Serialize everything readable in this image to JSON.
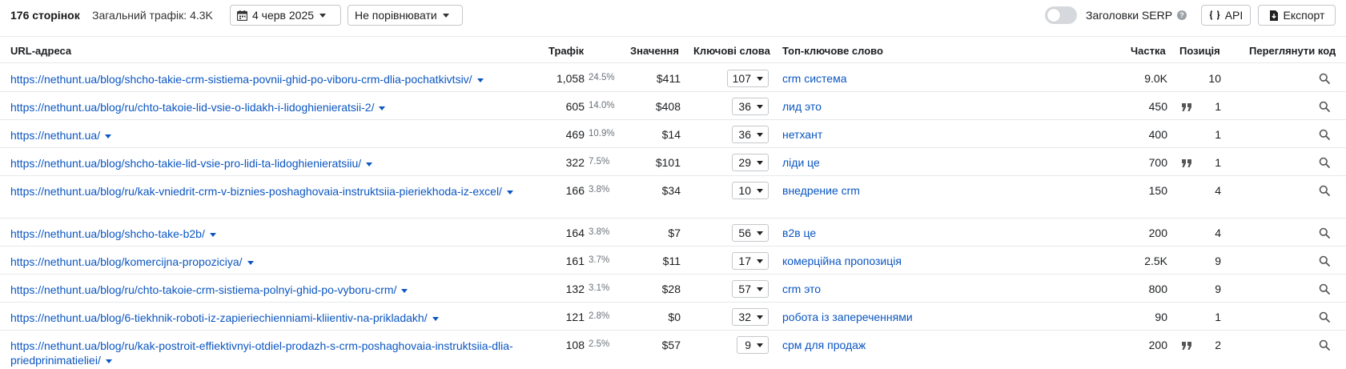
{
  "header": {
    "pages_count": "176 сторінок",
    "total_traffic": "Загальний трафік: 4.3K",
    "date_label": "4 черв 2025",
    "compare_label": "Не порівнювати",
    "serp_titles_label": "Заголовки SERP",
    "serp_toggle_on": false,
    "help_glyph": "?",
    "api_label": "API",
    "export_label": "Експорт"
  },
  "columns": {
    "url": "URL-адреса",
    "traffic": "Трафік",
    "value": "Значення",
    "keywords": "Ключові слова",
    "top_keyword": "Топ-ключове слово",
    "volume": "Частка",
    "position": "Позиція",
    "view_code": "Переглянути код"
  },
  "colors": {
    "link": "#0b56c2",
    "muted": "#6c737a",
    "border": "#e6e8ea"
  },
  "rows": [
    {
      "url": "https://nethunt.ua/blog/shcho-takie-crm-sistiema-povnii-ghid-po-viboru-crm-dlia-pochatkivtsiv/",
      "traffic": "1,058",
      "share": "24.5%",
      "value": "$411",
      "keywords": "107",
      "top_keyword": "crm система",
      "volume": "9.0K",
      "quote": false,
      "position": "10"
    },
    {
      "url": "https://nethunt.ua/blog/ru/chto-takoie-lid-vsie-o-lidakh-i-lidoghienieratsii-2/",
      "traffic": "605",
      "share": "14.0%",
      "value": "$408",
      "keywords": "36",
      "top_keyword": "лид это",
      "volume": "450",
      "quote": true,
      "position": "1"
    },
    {
      "url": "https://nethunt.ua/",
      "traffic": "469",
      "share": "10.9%",
      "value": "$14",
      "keywords": "36",
      "top_keyword": "нетхант",
      "volume": "400",
      "quote": false,
      "position": "1"
    },
    {
      "url": "https://nethunt.ua/blog/shcho-takie-lid-vsie-pro-lidi-ta-lidoghienieratsiiu/",
      "traffic": "322",
      "share": "7.5%",
      "value": "$101",
      "keywords": "29",
      "top_keyword": "ліди це",
      "volume": "700",
      "quote": true,
      "position": "1"
    },
    {
      "url": "https://nethunt.ua/blog/ru/kak-vniedrit-crm-v-biznies-poshaghovaia-instruktsiia-pieriekhoda-iz-excel/",
      "traffic": "166",
      "share": "3.8%",
      "value": "$34",
      "keywords": "10",
      "top_keyword": "внедрение crm",
      "volume": "150",
      "quote": false,
      "position": "4"
    },
    {
      "url": "https://nethunt.ua/blog/shcho-take-b2b/",
      "traffic": "164",
      "share": "3.8%",
      "value": "$7",
      "keywords": "56",
      "top_keyword": "в2в це",
      "volume": "200",
      "quote": false,
      "position": "4"
    },
    {
      "url": "https://nethunt.ua/blog/komercijna-propoziciya/",
      "traffic": "161",
      "share": "3.7%",
      "value": "$11",
      "keywords": "17",
      "top_keyword": "комерційна пропозиція",
      "volume": "2.5K",
      "quote": false,
      "position": "9"
    },
    {
      "url": "https://nethunt.ua/blog/ru/chto-takoie-crm-sistiema-polnyi-ghid-po-vyboru-crm/",
      "traffic": "132",
      "share": "3.1%",
      "value": "$28",
      "keywords": "57",
      "top_keyword": "crm это",
      "volume": "800",
      "quote": false,
      "position": "9"
    },
    {
      "url": "https://nethunt.ua/blog/6-tiekhnik-roboti-iz-zapieriechienniami-kliientiv-na-prikladakh/",
      "traffic": "121",
      "share": "2.8%",
      "value": "$0",
      "keywords": "32",
      "top_keyword": "робота із запереченнями",
      "volume": "90",
      "quote": false,
      "position": "1"
    },
    {
      "url": "https://nethunt.ua/blog/ru/kak-postroit-effiektivnyi-otdiel-prodazh-s-crm-poshaghovaia-instruktsiia-dlia-priedprinimatieliei/",
      "traffic": "108",
      "share": "2.5%",
      "value": "$57",
      "keywords": "9",
      "top_keyword": "срм для продаж",
      "volume": "200",
      "quote": true,
      "position": "2"
    }
  ]
}
